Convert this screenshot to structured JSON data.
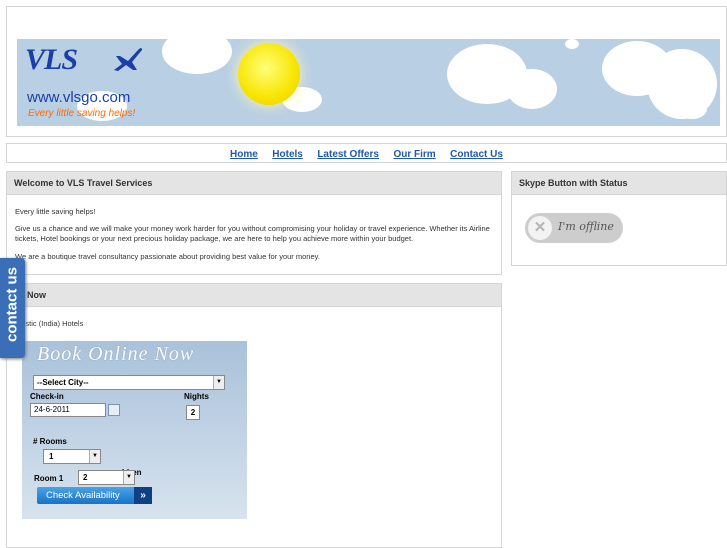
{
  "header": {
    "logo_text": "VLS",
    "site_url": "www.vlsgo.com",
    "tagline": "Every little saving helps!"
  },
  "nav": {
    "items": [
      "Home",
      "Hotels",
      "Latest Offers",
      "Our Firm",
      "Contact Us"
    ]
  },
  "welcome": {
    "title": "Welcome to VLS Travel Services",
    "line1": "Every little saving helps!",
    "line2": "Give us a chance and we will make your money work harder for you without compromising your holiday or travel experience. Whether its Airline tickets, Hotel bookings or your next precious holiday package, we are here to help you achieve more within your budget.",
    "line3": "We are a boutique travel consultancy passionate about providing best value for your money."
  },
  "book": {
    "title": "ok Now",
    "subtitle": "mestic (India) Hotels",
    "widget_title": "Book Online Now",
    "city_select": "--Select City--",
    "checkin_label": "Check-in",
    "checkin_value": "24-6-2011",
    "nights_label": "Nights",
    "nights_value": "2",
    "rooms_label": "# Rooms",
    "rooms_value": "1",
    "children_label": "ldren",
    "room1_label": "Room 1",
    "room1_value": "2",
    "check_button": "Check Availability"
  },
  "skype": {
    "title": "Skype Button with Status",
    "status": "I'm offline"
  },
  "contact_tab": "contact us",
  "colors": {
    "nav_link": "#1e5aa8",
    "banner_bg": "#b9cfe4",
    "contact_tab": "#3a6fb8",
    "tagline": "#ff6a00"
  }
}
